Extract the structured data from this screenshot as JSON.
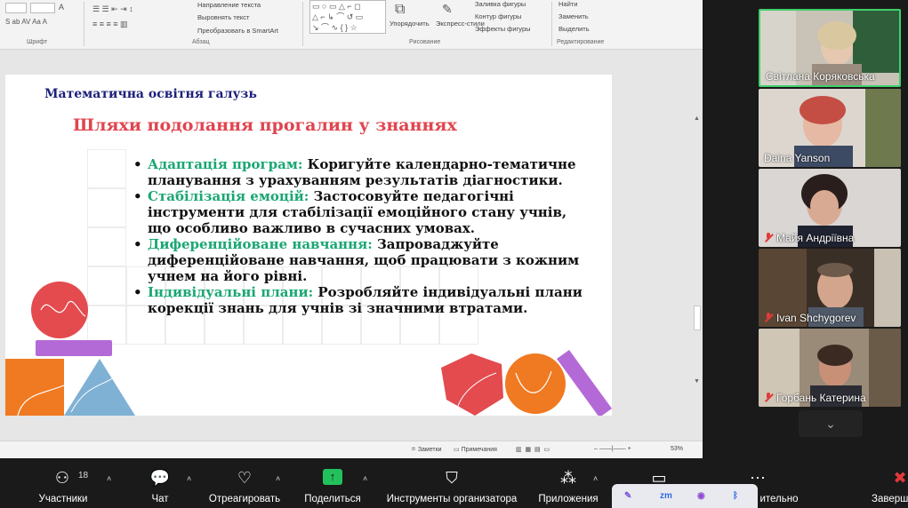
{
  "ribbon": {
    "text_direction": "Направление текста",
    "align_text": "Выровнять текст",
    "smartart": "Преобразовать в SmartArt",
    "font_group": "Шрифт",
    "paragraph_group": "Абзац",
    "drawing_group": "Рисование",
    "editing_group": "Редактирование",
    "arrange": "Упорядочить",
    "quick_styles": "Экспресс-стили",
    "shape_fill": "Заливка фигуры",
    "shape_outline": "Контур фигуры",
    "shape_effects": "Эффекты фигуры",
    "find": "Найти",
    "replace": "Заменить",
    "select": "Выделить"
  },
  "slide": {
    "category": "Математична освітня галузь",
    "title": "Шляхи подолання прогалин у знаннях",
    "bullets": [
      {
        "head": "Адаптація програм:",
        "body": " Коригуйте календарно-тематичне планування з урахуванням результатів діагностики."
      },
      {
        "head": "Стабілізація емоцій:",
        "body": " Застосовуйте педагогічні інструменти для стабілізації емоційного стану учнів, що особливо важливо в сучасних умовах."
      },
      {
        "head": "Диференційоване навчання:",
        "body": " Запроваджуйте диференційоване навчання, щоб працювати з кожним учнем на його рівні."
      },
      {
        "head": "Індивідуальні плани:",
        "body": " Розробляйте індивідуальні плани корекції знань для учнів зі значними втратами."
      }
    ]
  },
  "statusbar": {
    "notes": "Заметки",
    "comments": "Примечания",
    "zoom": "53%"
  },
  "participants": [
    {
      "name": "Світлана Коряковська",
      "muted": false,
      "active": true
    },
    {
      "name": "Daina Yanson",
      "muted": false,
      "active": false
    },
    {
      "name": "Майя Андріївна",
      "muted": true,
      "active": false
    },
    {
      "name": "Ivan Shchygorev",
      "muted": true,
      "active": false
    },
    {
      "name": "Горбань Катерина",
      "muted": true,
      "active": false
    }
  ],
  "toolbar": {
    "participants_label": "Участники",
    "participants_count": "18",
    "chat_label": "Чат",
    "react_label": "Отреагировать",
    "share_label": "Поделиться",
    "host_tools_label": "Инструменты организатора",
    "apps_label": "Приложения",
    "more_label": "ительно",
    "end_label": "Заверш"
  },
  "colors": {
    "title": "#e0454f",
    "category": "#1d1f7a",
    "bullet_head": "#1aa772",
    "active_speaker": "#3fd06a",
    "share_green": "#23c15b"
  }
}
